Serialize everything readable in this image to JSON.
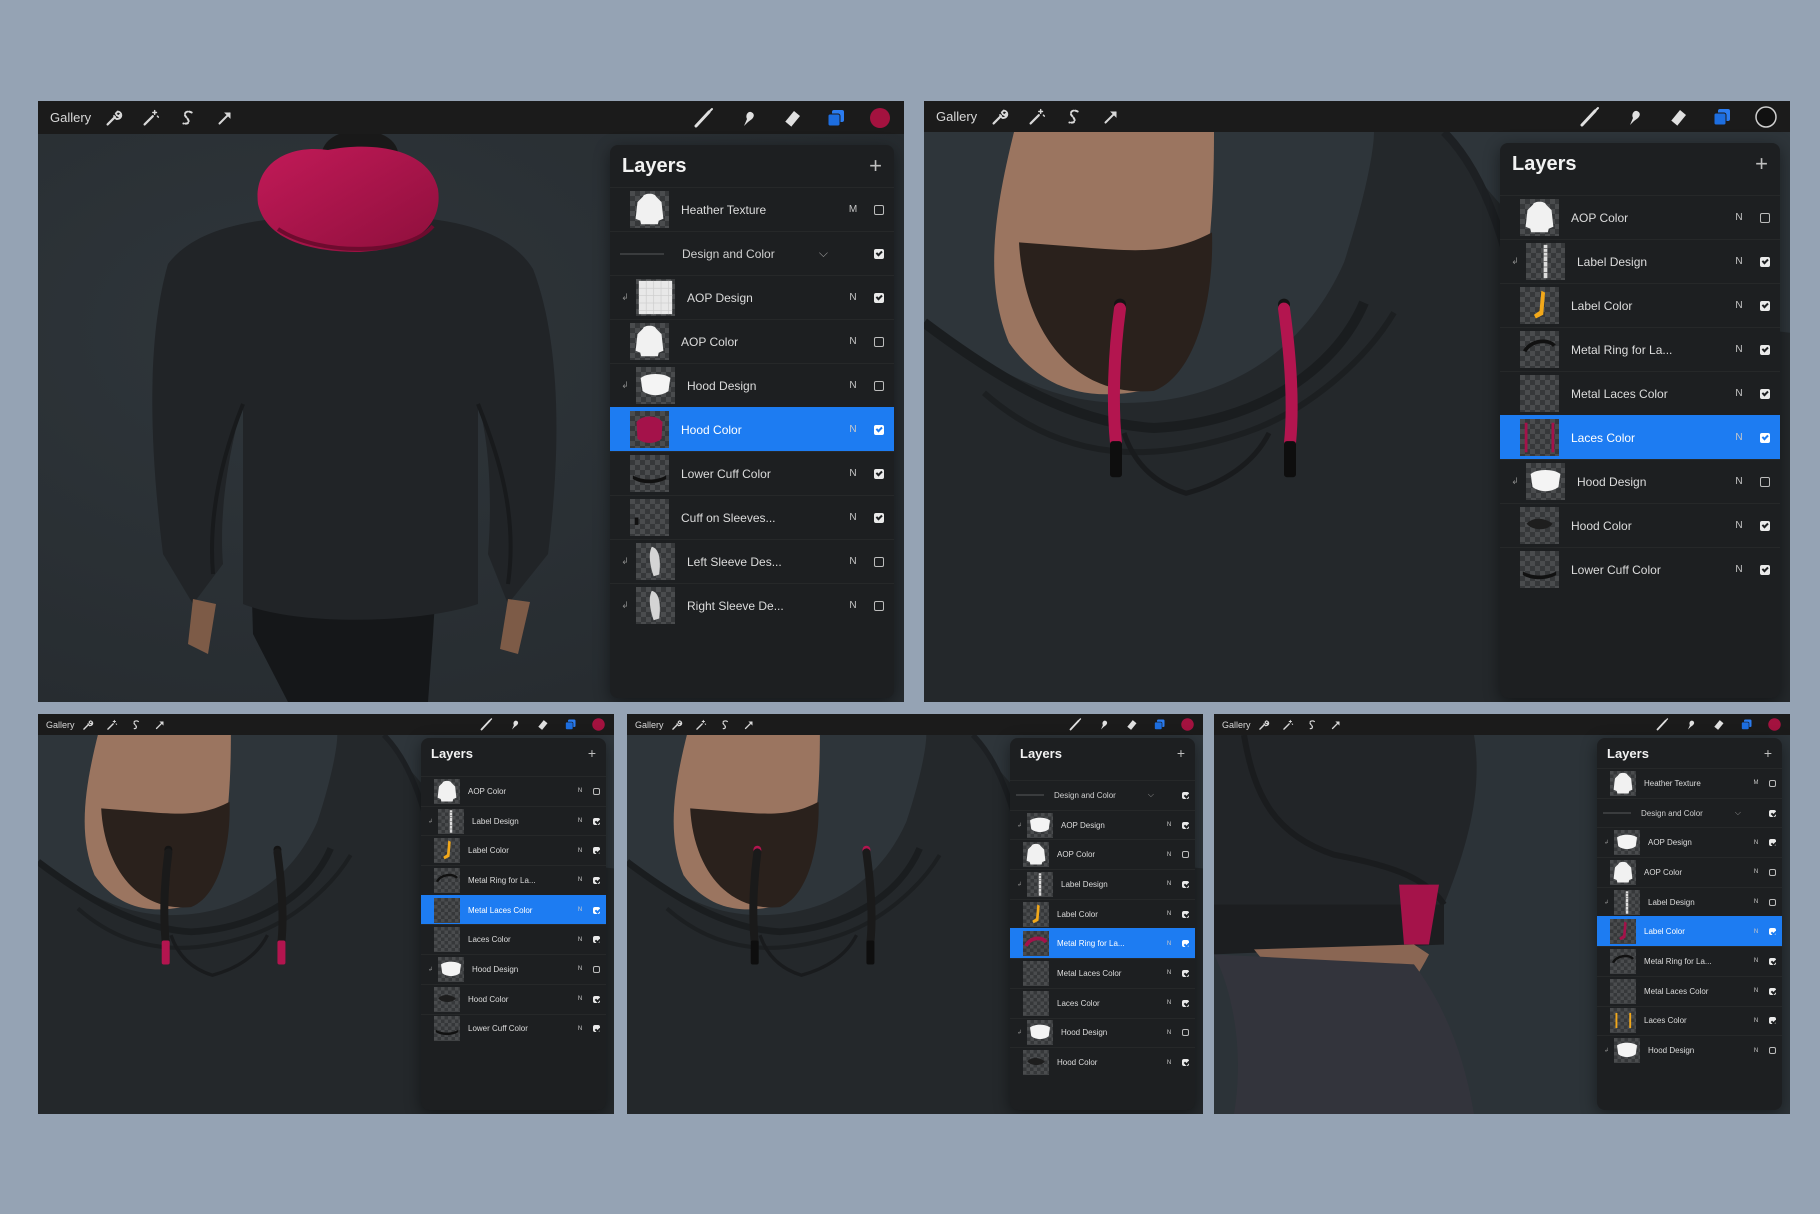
{
  "colors": {
    "background": "#95a3b4",
    "toolbar": "#1b1b1b",
    "panel": "#1d1f21",
    "selected_row": "#1d7cf2",
    "accent_magenta": "#b0174f",
    "hoodie": "#24272a"
  },
  "toolbar": {
    "gallery_label": "Gallery",
    "left_icons": [
      "wrench-icon",
      "magic-wand-icon",
      "selection-s-icon",
      "transform-arrow-icon"
    ],
    "right_icons": [
      "brush-icon",
      "smudge-icon",
      "eraser-icon",
      "layers-icon",
      "color-swatch"
    ]
  },
  "screens": [
    {
      "id": "back-view",
      "current_color": "#a3123f",
      "photo": "hoodie back view with magenta hood lining",
      "layers": {
        "title": "Layers",
        "add_label": "+",
        "rows": [
          {
            "name": "Heather Texture",
            "mode": "M",
            "checked": false,
            "thumb": "white-hoodie",
            "clip": false
          },
          {
            "name": "Design and Color",
            "mode": "",
            "checked": true,
            "thumb": "",
            "group": true
          },
          {
            "name": "AOP  Design",
            "mode": "N",
            "checked": true,
            "thumb": "pattern",
            "clip": true
          },
          {
            "name": "AOP Color",
            "mode": "N",
            "checked": false,
            "thumb": "white-hoodie",
            "clip": false
          },
          {
            "name": "Hood Design",
            "mode": "N",
            "checked": false,
            "thumb": "white-hood",
            "clip": true
          },
          {
            "name": "Hood Color",
            "mode": "N",
            "checked": true,
            "thumb": "magenta-hood",
            "clip": false,
            "selected": true
          },
          {
            "name": "Lower Cuff Color",
            "mode": "N",
            "checked": true,
            "thumb": "dark-band",
            "clip": false
          },
          {
            "name": "Cuff on Sleeves...",
            "mode": "N",
            "checked": true,
            "thumb": "dark-bits",
            "clip": false
          },
          {
            "name": "Left Sleeve Des...",
            "mode": "N",
            "checked": false,
            "thumb": "sleeve",
            "clip": true
          },
          {
            "name": "Right Sleeve De...",
            "mode": "N",
            "checked": false,
            "thumb": "sleeve",
            "clip": true
          }
        ]
      }
    },
    {
      "id": "laces-closeup",
      "current_color": "#111111",
      "photo": "bearded man in black hoodie with magenta drawstrings",
      "layers": {
        "title": "Layers",
        "add_label": "+",
        "rows": [
          {
            "name": "AOP Color",
            "mode": "N",
            "checked": false,
            "thumb": "white-hoodie",
            "clip": false
          },
          {
            "name": "Label Design",
            "mode": "N",
            "checked": true,
            "thumb": "label-strip",
            "clip": true
          },
          {
            "name": "Label Color",
            "mode": "N",
            "checked": true,
            "thumb": "yellow-label",
            "clip": false
          },
          {
            "name": "Metal Ring for La...",
            "mode": "N",
            "checked": true,
            "thumb": "dark-ring",
            "clip": false
          },
          {
            "name": "Metal Laces Color",
            "mode": "N",
            "checked": true,
            "thumb": "empty",
            "clip": false
          },
          {
            "name": "Laces Color",
            "mode": "N",
            "checked": true,
            "thumb": "magenta-laces",
            "clip": false,
            "selected": true
          },
          {
            "name": "Hood Design",
            "mode": "N",
            "checked": false,
            "thumb": "white-hood",
            "clip": true
          },
          {
            "name": "Hood Color",
            "mode": "N",
            "checked": true,
            "thumb": "dark-hood",
            "clip": false
          },
          {
            "name": "Lower Cuff Color",
            "mode": "N",
            "checked": true,
            "thumb": "dark-band",
            "clip": false
          }
        ]
      }
    },
    {
      "id": "metal-tips",
      "current_color": "#a3123f",
      "photo": "hoodie drawstrings with magenta metal tips",
      "layers": {
        "title": "Layers",
        "add_label": "+",
        "rows": [
          {
            "name": "AOP Color",
            "mode": "N",
            "checked": false,
            "thumb": "white-hoodie",
            "clip": false
          },
          {
            "name": "Label Design",
            "mode": "N",
            "checked": true,
            "thumb": "label-strip",
            "clip": true
          },
          {
            "name": "Label Color",
            "mode": "N",
            "checked": true,
            "thumb": "yellow-label",
            "clip": false
          },
          {
            "name": "Metal Ring for La...",
            "mode": "N",
            "checked": true,
            "thumb": "dark-ring",
            "clip": false
          },
          {
            "name": "Metal Laces Color",
            "mode": "N",
            "checked": true,
            "thumb": "empty",
            "clip": false,
            "selected": true
          },
          {
            "name": "Laces Color",
            "mode": "N",
            "checked": true,
            "thumb": "empty",
            "clip": false
          },
          {
            "name": "Hood Design",
            "mode": "N",
            "checked": false,
            "thumb": "white-hood",
            "clip": true
          },
          {
            "name": "Hood Color",
            "mode": "N",
            "checked": true,
            "thumb": "dark-hood",
            "clip": false
          },
          {
            "name": "Lower Cuff Color",
            "mode": "N",
            "checked": true,
            "thumb": "dark-band",
            "clip": false
          }
        ]
      }
    },
    {
      "id": "metal-ring",
      "current_color": "#a3123f",
      "photo": "hoodie with magenta metal ring at neck",
      "layers": {
        "title": "Layers",
        "add_label": "+",
        "rows": [
          {
            "name": "Design and Color",
            "mode": "",
            "checked": true,
            "thumb": "",
            "group": true
          },
          {
            "name": "AOP  Design",
            "mode": "N",
            "checked": true,
            "thumb": "white-hood",
            "clip": true
          },
          {
            "name": "AOP Color",
            "mode": "N",
            "checked": false,
            "thumb": "white-hoodie",
            "clip": false
          },
          {
            "name": "Label Design",
            "mode": "N",
            "checked": true,
            "thumb": "label-strip",
            "clip": true
          },
          {
            "name": "Label Color",
            "mode": "N",
            "checked": true,
            "thumb": "yellow-label",
            "clip": false
          },
          {
            "name": "Metal Ring for La...",
            "mode": "N",
            "checked": true,
            "thumb": "magenta-ring",
            "clip": false,
            "selected": true
          },
          {
            "name": "Metal Laces Color",
            "mode": "N",
            "checked": true,
            "thumb": "empty",
            "clip": false
          },
          {
            "name": "Laces Color",
            "mode": "N",
            "checked": true,
            "thumb": "empty",
            "clip": false
          },
          {
            "name": "Hood Design",
            "mode": "N",
            "checked": false,
            "thumb": "white-hood",
            "clip": true
          },
          {
            "name": "Hood Color",
            "mode": "N",
            "checked": true,
            "thumb": "dark-hood",
            "clip": false
          }
        ]
      }
    },
    {
      "id": "sleeve-label",
      "current_color": "#a3123f",
      "photo": "hoodie sleeve cuff with magenta label",
      "layers": {
        "title": "Layers",
        "add_label": "+",
        "rows": [
          {
            "name": "Heather Texture",
            "mode": "M",
            "checked": false,
            "thumb": "white-hoodie",
            "clip": false
          },
          {
            "name": "Design and Color",
            "mode": "",
            "checked": true,
            "thumb": "",
            "group": true
          },
          {
            "name": "AOP  Design",
            "mode": "N",
            "checked": true,
            "thumb": "white-hood",
            "clip": true
          },
          {
            "name": "AOP Color",
            "mode": "N",
            "checked": false,
            "thumb": "white-hoodie",
            "clip": false
          },
          {
            "name": "Label Design",
            "mode": "N",
            "checked": false,
            "thumb": "label-strip",
            "clip": true
          },
          {
            "name": "Label Color",
            "mode": "N",
            "checked": true,
            "thumb": "magenta-label",
            "clip": false,
            "selected": true
          },
          {
            "name": "Metal Ring for La...",
            "mode": "N",
            "checked": true,
            "thumb": "dark-ring",
            "clip": false
          },
          {
            "name": "Metal Laces Color",
            "mode": "N",
            "checked": true,
            "thumb": "empty",
            "clip": false
          },
          {
            "name": "Laces Color",
            "mode": "N",
            "checked": true,
            "thumb": "yellow-laces",
            "clip": false
          },
          {
            "name": "Hood Design",
            "mode": "N",
            "checked": false,
            "thumb": "white-hood",
            "clip": true
          }
        ]
      }
    }
  ]
}
